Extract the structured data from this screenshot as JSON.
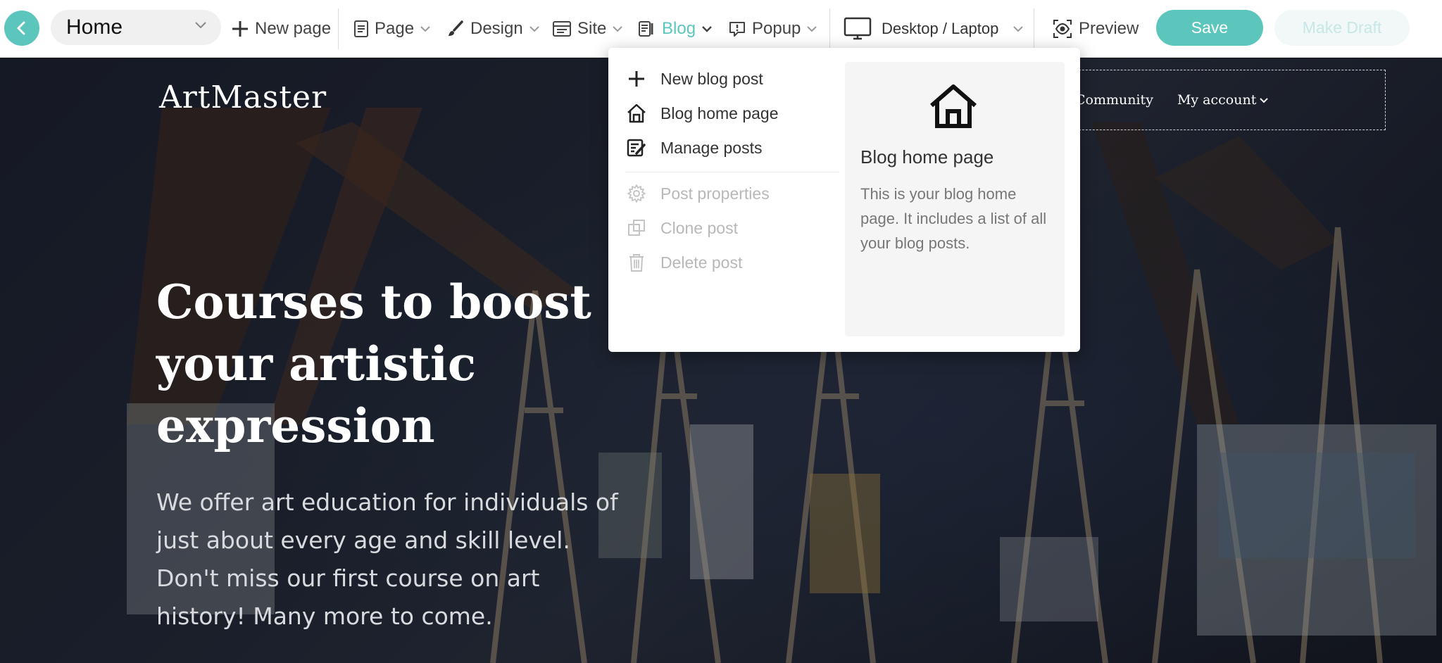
{
  "toolbar": {
    "page_select": "Home",
    "new_page": "New page",
    "page": "Page",
    "design": "Design",
    "site": "Site",
    "blog": "Blog",
    "popup": "Popup",
    "device": "Desktop / Laptop",
    "preview": "Preview",
    "save": "Save",
    "make_draft": "Make Draft",
    "accent_color": "#5cc6bd"
  },
  "site": {
    "logo": "ArtMaster",
    "nav": [
      "Community",
      "My account"
    ],
    "hero_title": "Courses to boost your artistic expression",
    "hero_text": "We offer art education for individuals of just about every age and skill level. Don't miss our first course on art history! Many more to come."
  },
  "blog_menu": {
    "items": [
      {
        "label": "New blog post",
        "icon": "plus-icon",
        "enabled": true
      },
      {
        "label": "Blog home page",
        "icon": "home-icon",
        "enabled": true
      },
      {
        "label": "Manage posts",
        "icon": "edit-list-icon",
        "enabled": true
      },
      {
        "label": "Post properties",
        "icon": "gear-icon",
        "enabled": false
      },
      {
        "label": "Clone post",
        "icon": "clone-icon",
        "enabled": false
      },
      {
        "label": "Delete post",
        "icon": "trash-icon",
        "enabled": false
      }
    ],
    "preview": {
      "title": "Blog home page",
      "description": "This is your blog home page. It includes a list of all your blog posts."
    }
  }
}
